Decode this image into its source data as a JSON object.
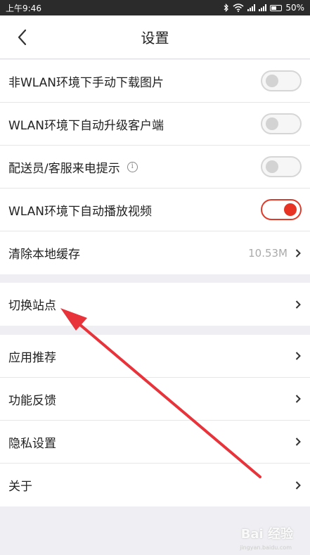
{
  "status": {
    "time": "上午9:46",
    "battery": "50%"
  },
  "nav": {
    "title": "设置"
  },
  "toggles": [
    {
      "label": "非WLAN环境下手动下载图片",
      "on": false
    },
    {
      "label": "WLAN环境下自动升级客户端",
      "on": false
    },
    {
      "label": "配送员/客服来电提示",
      "on": false,
      "info": "i"
    },
    {
      "label": "WLAN环境下自动播放视频",
      "on": true
    }
  ],
  "cache": {
    "label": "清除本地缓存",
    "value": "10.53M"
  },
  "site": {
    "label": "切换站点"
  },
  "more": [
    {
      "label": "应用推荐"
    },
    {
      "label": "功能反馈"
    },
    {
      "label": "隐私设置"
    },
    {
      "label": "关于"
    }
  ],
  "watermark": {
    "text": "Bai 经验",
    "sub": "jingyan.baidu.com"
  },
  "colors": {
    "accent": "#e63323",
    "background": "#efeff3"
  }
}
